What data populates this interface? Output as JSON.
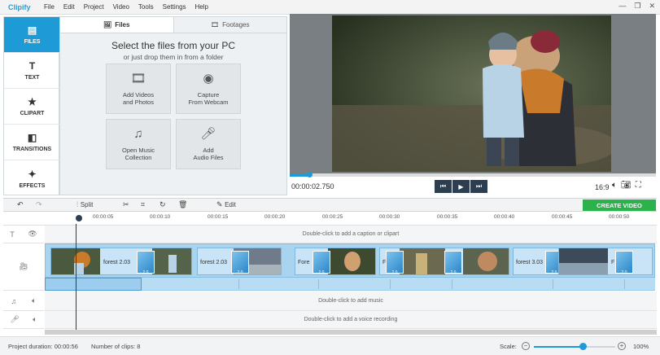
{
  "app": {
    "title": "Clipify"
  },
  "menu": [
    "File",
    "Edit",
    "Project",
    "Video",
    "Tools",
    "Settings",
    "Help"
  ],
  "window_controls": {
    "minimize": "—",
    "maximize": "❐",
    "close": "✕"
  },
  "sidebar": {
    "items": [
      {
        "label": "FILES",
        "icon": "files-icon",
        "active": true
      },
      {
        "label": "TEXT",
        "icon": "text-icon",
        "active": false
      },
      {
        "label": "CLIPART",
        "icon": "star-icon",
        "active": false
      },
      {
        "label": "TRANSITIONS",
        "icon": "transitions-icon",
        "active": false
      },
      {
        "label": "EFFECTS",
        "icon": "magic-wand-icon",
        "active": false
      }
    ]
  },
  "media_panel": {
    "tabs": [
      {
        "label": "Files",
        "active": true
      },
      {
        "label": "Footages",
        "active": false
      }
    ],
    "heading": "Select the files from your PC",
    "subheading": "or just drop them in from a folder",
    "tiles": [
      {
        "label_line1": "Add Videos",
        "label_line2": "and Photos",
        "icon": "film-reel-icon"
      },
      {
        "label_line1": "Capture",
        "label_line2": "From Webcam",
        "icon": "webcam-icon"
      },
      {
        "label_line1": "Open Music",
        "label_line2": "Collection",
        "icon": "music-notes-icon"
      },
      {
        "label_line1": "Add",
        "label_line2": "Audio Files",
        "icon": "microphone-icon"
      }
    ]
  },
  "player": {
    "timecode": "00:00:02.750",
    "aspect_ratio": "16:9",
    "progress_fraction": 0.05,
    "controls": [
      "skip-back-icon",
      "play-icon",
      "skip-forward-icon"
    ]
  },
  "toolbar": {
    "split_label": "Split",
    "edit_label": "Edit",
    "create_label": "CREATE VIDEO"
  },
  "ruler": {
    "labels": [
      "00:00:05",
      "00:00:10",
      "00:00:15",
      "00:00:20",
      "00:00:25",
      "00:00:30",
      "00:00:35",
      "00:00:40",
      "00:00:45",
      "00:00:50"
    ]
  },
  "tracks": {
    "caption_hint": "Double-click to add a caption or clipart",
    "music_hint": "Double-click to add music",
    "voice_hint": "Double-click to add a voice recording",
    "clip_names": [
      "forest 2.03",
      "forest 2.03",
      "Fore",
      "F",
      "forest 3.03",
      "F"
    ],
    "transition_label": "2.0"
  },
  "status": {
    "duration_label": "Project duration: 00:00:56",
    "clips_label": "Number of clips: 8",
    "scale_label": "Scale:",
    "zoom": "100%",
    "scale_fraction": 0.6
  },
  "colors": {
    "accent": "#1e9ad6",
    "create": "#2bb24c",
    "player_button": "#2d3e50"
  }
}
